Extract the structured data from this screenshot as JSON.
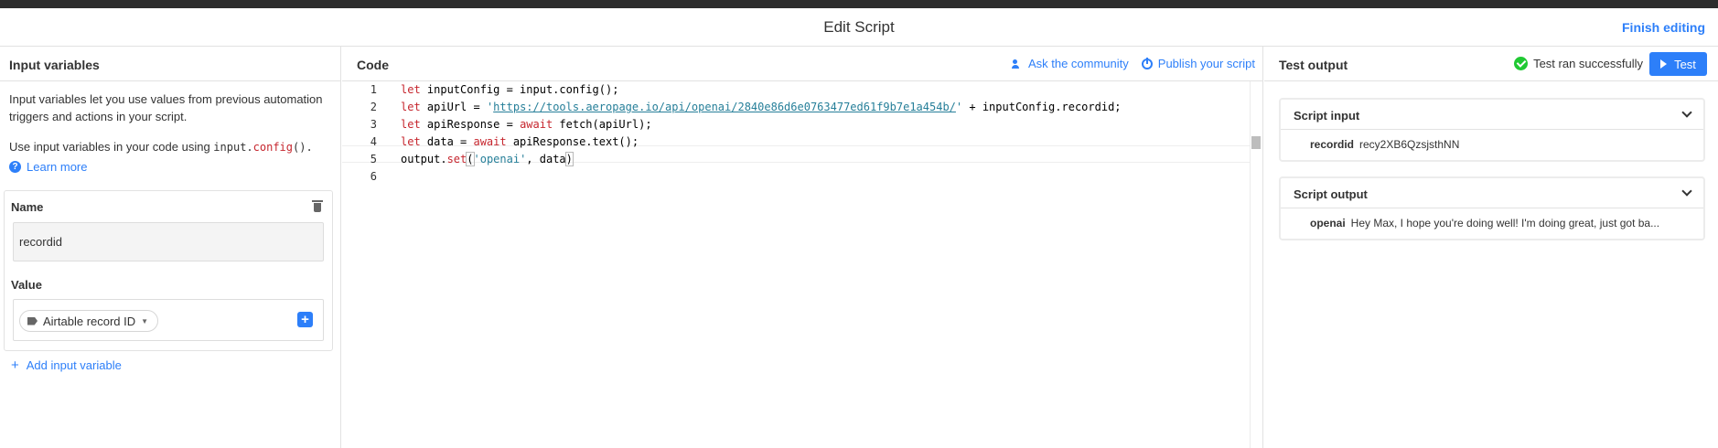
{
  "header": {
    "title": "Edit Script",
    "finish_label": "Finish editing"
  },
  "left": {
    "title": "Input variables",
    "description": "Input variables let you use values from previous automation triggers and actions in your script.",
    "usage_prefix": "Use input variables in your code using ",
    "usage_code_a": "input.",
    "usage_code_kw": "config",
    "usage_code_b": "().",
    "learn_more": "Learn more",
    "variable": {
      "name_label": "Name",
      "name_value": "recordid",
      "value_label": "Value",
      "value_chip": "Airtable record ID"
    },
    "add_label": "Add input variable"
  },
  "middle": {
    "title": "Code",
    "ask_label": "Ask the community",
    "publish_label": "Publish your script",
    "line_numbers": [
      "1",
      "2",
      "3",
      "4",
      "5",
      "6"
    ],
    "code": {
      "l1": [
        "let",
        " inputConfig = input.config();"
      ],
      "l2": [
        "let",
        " apiUrl = ",
        "'",
        "https://tools.aeropage.io/api/openai/2840e86d6e0763477ed61f9b7e1a454b/",
        "'",
        " + inputConfig.recordid;"
      ],
      "l3": [
        "let",
        " apiResponse = ",
        "await",
        " fetch(apiUrl);"
      ],
      "l4": [
        "let",
        " data = ",
        "await",
        " apiResponse.text();"
      ],
      "l5": [
        "output.",
        "set",
        "(",
        "'openai'",
        ", data",
        ")"
      ]
    }
  },
  "right": {
    "title": "Test output",
    "status": "Test ran successfully",
    "test_label": "Test",
    "input_card": {
      "title": "Script input",
      "key": "recordid",
      "value": "recy2XB6QzsjsthNN"
    },
    "output_card": {
      "title": "Script output",
      "key": "openai",
      "value": "Hey Max, I hope you're doing well! I'm doing great, just got ba..."
    }
  },
  "colors": {
    "accent": "#2d7ff9",
    "success": "#20c933",
    "keyword": "#c6262e",
    "string": "#267f99"
  }
}
